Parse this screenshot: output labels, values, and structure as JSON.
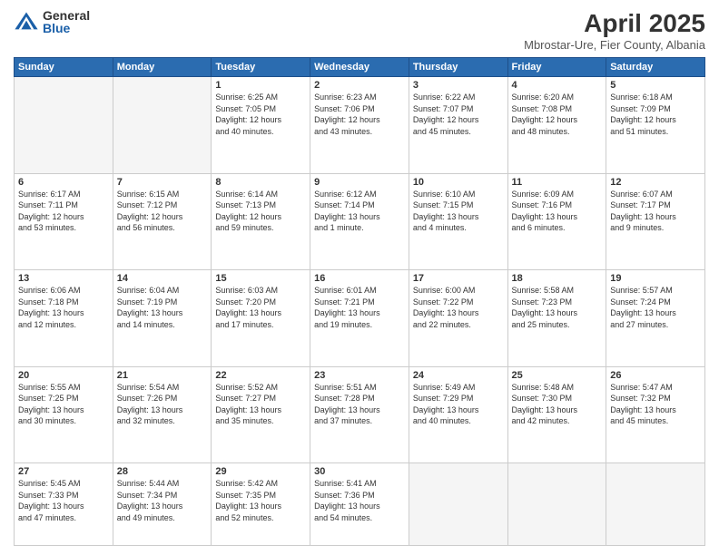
{
  "logo": {
    "general": "General",
    "blue": "Blue"
  },
  "header": {
    "month_title": "April 2025",
    "location": "Mbrostar-Ure, Fier County, Albania"
  },
  "weekdays": [
    "Sunday",
    "Monday",
    "Tuesday",
    "Wednesday",
    "Thursday",
    "Friday",
    "Saturday"
  ],
  "weeks": [
    [
      {
        "day": "",
        "info": ""
      },
      {
        "day": "",
        "info": ""
      },
      {
        "day": "1",
        "info": "Sunrise: 6:25 AM\nSunset: 7:05 PM\nDaylight: 12 hours\nand 40 minutes."
      },
      {
        "day": "2",
        "info": "Sunrise: 6:23 AM\nSunset: 7:06 PM\nDaylight: 12 hours\nand 43 minutes."
      },
      {
        "day": "3",
        "info": "Sunrise: 6:22 AM\nSunset: 7:07 PM\nDaylight: 12 hours\nand 45 minutes."
      },
      {
        "day": "4",
        "info": "Sunrise: 6:20 AM\nSunset: 7:08 PM\nDaylight: 12 hours\nand 48 minutes."
      },
      {
        "day": "5",
        "info": "Sunrise: 6:18 AM\nSunset: 7:09 PM\nDaylight: 12 hours\nand 51 minutes."
      }
    ],
    [
      {
        "day": "6",
        "info": "Sunrise: 6:17 AM\nSunset: 7:11 PM\nDaylight: 12 hours\nand 53 minutes."
      },
      {
        "day": "7",
        "info": "Sunrise: 6:15 AM\nSunset: 7:12 PM\nDaylight: 12 hours\nand 56 minutes."
      },
      {
        "day": "8",
        "info": "Sunrise: 6:14 AM\nSunset: 7:13 PM\nDaylight: 12 hours\nand 59 minutes."
      },
      {
        "day": "9",
        "info": "Sunrise: 6:12 AM\nSunset: 7:14 PM\nDaylight: 13 hours\nand 1 minute."
      },
      {
        "day": "10",
        "info": "Sunrise: 6:10 AM\nSunset: 7:15 PM\nDaylight: 13 hours\nand 4 minutes."
      },
      {
        "day": "11",
        "info": "Sunrise: 6:09 AM\nSunset: 7:16 PM\nDaylight: 13 hours\nand 6 minutes."
      },
      {
        "day": "12",
        "info": "Sunrise: 6:07 AM\nSunset: 7:17 PM\nDaylight: 13 hours\nand 9 minutes."
      }
    ],
    [
      {
        "day": "13",
        "info": "Sunrise: 6:06 AM\nSunset: 7:18 PM\nDaylight: 13 hours\nand 12 minutes."
      },
      {
        "day": "14",
        "info": "Sunrise: 6:04 AM\nSunset: 7:19 PM\nDaylight: 13 hours\nand 14 minutes."
      },
      {
        "day": "15",
        "info": "Sunrise: 6:03 AM\nSunset: 7:20 PM\nDaylight: 13 hours\nand 17 minutes."
      },
      {
        "day": "16",
        "info": "Sunrise: 6:01 AM\nSunset: 7:21 PM\nDaylight: 13 hours\nand 19 minutes."
      },
      {
        "day": "17",
        "info": "Sunrise: 6:00 AM\nSunset: 7:22 PM\nDaylight: 13 hours\nand 22 minutes."
      },
      {
        "day": "18",
        "info": "Sunrise: 5:58 AM\nSunset: 7:23 PM\nDaylight: 13 hours\nand 25 minutes."
      },
      {
        "day": "19",
        "info": "Sunrise: 5:57 AM\nSunset: 7:24 PM\nDaylight: 13 hours\nand 27 minutes."
      }
    ],
    [
      {
        "day": "20",
        "info": "Sunrise: 5:55 AM\nSunset: 7:25 PM\nDaylight: 13 hours\nand 30 minutes."
      },
      {
        "day": "21",
        "info": "Sunrise: 5:54 AM\nSunset: 7:26 PM\nDaylight: 13 hours\nand 32 minutes."
      },
      {
        "day": "22",
        "info": "Sunrise: 5:52 AM\nSunset: 7:27 PM\nDaylight: 13 hours\nand 35 minutes."
      },
      {
        "day": "23",
        "info": "Sunrise: 5:51 AM\nSunset: 7:28 PM\nDaylight: 13 hours\nand 37 minutes."
      },
      {
        "day": "24",
        "info": "Sunrise: 5:49 AM\nSunset: 7:29 PM\nDaylight: 13 hours\nand 40 minutes."
      },
      {
        "day": "25",
        "info": "Sunrise: 5:48 AM\nSunset: 7:30 PM\nDaylight: 13 hours\nand 42 minutes."
      },
      {
        "day": "26",
        "info": "Sunrise: 5:47 AM\nSunset: 7:32 PM\nDaylight: 13 hours\nand 45 minutes."
      }
    ],
    [
      {
        "day": "27",
        "info": "Sunrise: 5:45 AM\nSunset: 7:33 PM\nDaylight: 13 hours\nand 47 minutes."
      },
      {
        "day": "28",
        "info": "Sunrise: 5:44 AM\nSunset: 7:34 PM\nDaylight: 13 hours\nand 49 minutes."
      },
      {
        "day": "29",
        "info": "Sunrise: 5:42 AM\nSunset: 7:35 PM\nDaylight: 13 hours\nand 52 minutes."
      },
      {
        "day": "30",
        "info": "Sunrise: 5:41 AM\nSunset: 7:36 PM\nDaylight: 13 hours\nand 54 minutes."
      },
      {
        "day": "",
        "info": ""
      },
      {
        "day": "",
        "info": ""
      },
      {
        "day": "",
        "info": ""
      }
    ]
  ]
}
